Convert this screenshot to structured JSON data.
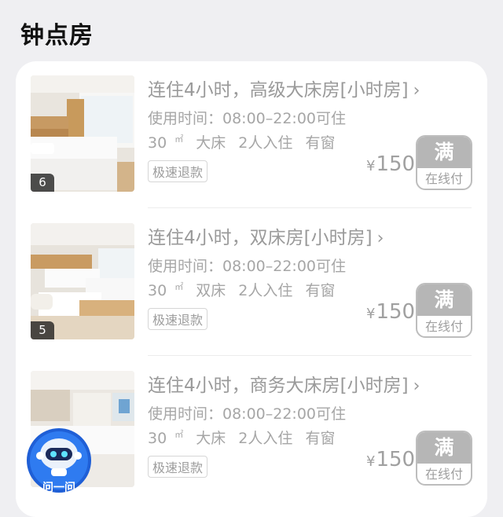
{
  "section": {
    "title": "钟点房"
  },
  "rooms": [
    {
      "title": "连住4小时，高级大床房[小时房]",
      "photo_count": "6",
      "usage": "使用时间：08:00–22:00可住",
      "area": "30",
      "area_unit": "㎡",
      "bed": "大床",
      "occupancy": "2人入住",
      "window": "有窗",
      "tag": "极速退款",
      "currency": "¥",
      "price": "150",
      "status": "满",
      "pay": "在线付"
    },
    {
      "title": "连住4小时，双床房[小时房]",
      "photo_count": "5",
      "usage": "使用时间：08:00–22:00可住",
      "area": "30",
      "area_unit": "㎡",
      "bed": "双床",
      "occupancy": "2人入住",
      "window": "有窗",
      "tag": "极速退款",
      "currency": "¥",
      "price": "150",
      "status": "满",
      "pay": "在线付"
    },
    {
      "title": "连住4小时，商务大床房[小时房]",
      "photo_count": "",
      "usage": "使用时间：08:00–22:00可住",
      "area": "30",
      "area_unit": "㎡",
      "bed": "大床",
      "occupancy": "2人入住",
      "window": "有窗",
      "tag": "极速退款",
      "currency": "¥",
      "price": "150",
      "status": "满",
      "pay": "在线付"
    }
  ],
  "assistant": {
    "label": "问一问"
  },
  "icons": {
    "chevron": "chevron-right-icon",
    "assistant": "robot-assistant-icon"
  },
  "colors": {
    "background": "#efeff2",
    "card": "#ffffff",
    "full_badge": "#b6b6b6"
  }
}
